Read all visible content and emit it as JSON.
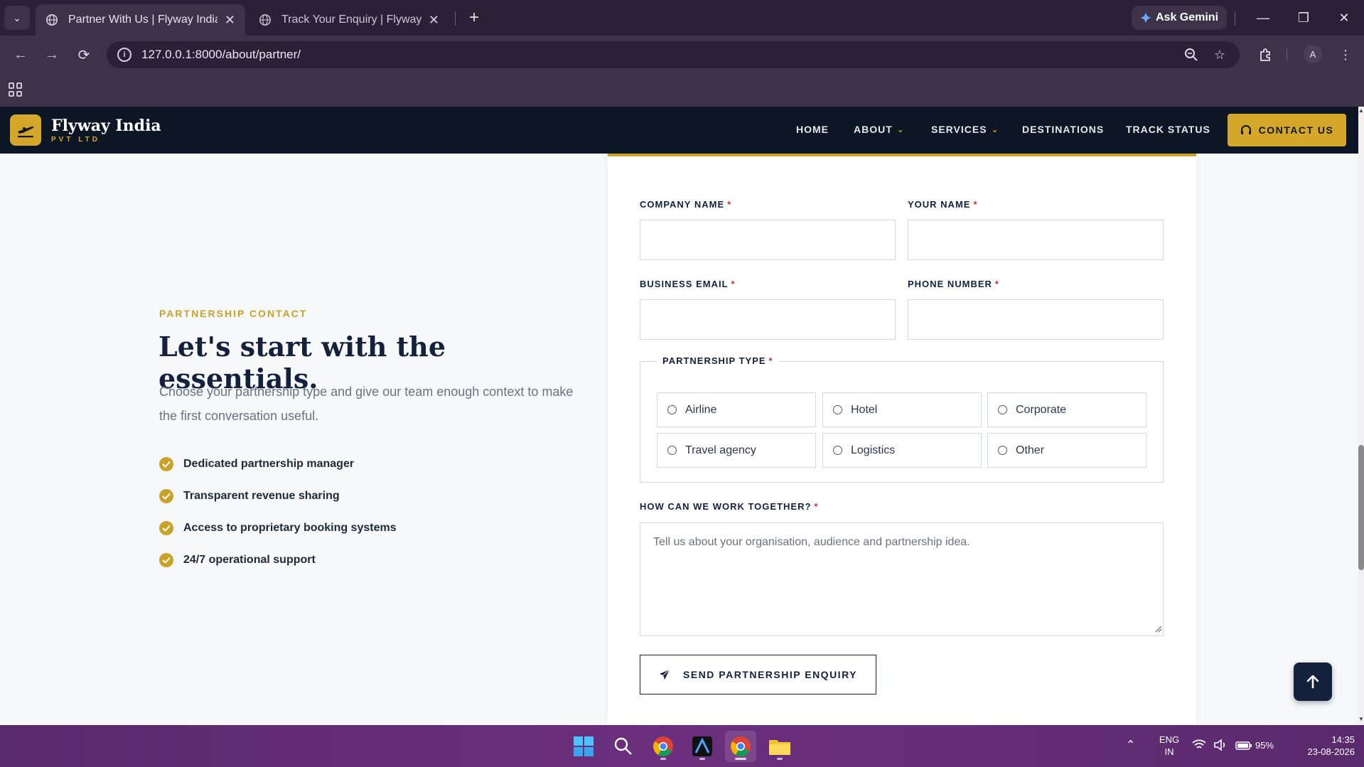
{
  "browser": {
    "tabs": [
      {
        "title": "Partner With Us | Flyway India",
        "active": true
      },
      {
        "title": "Track Your Enquiry | Flyway India",
        "active": false
      }
    ],
    "gemini_label": "Ask Gemini",
    "url": "127.0.0.1:8000/about/partner/",
    "profile_initial": "A"
  },
  "site": {
    "brand": "Flyway India",
    "brand_sub": "PVT LTD",
    "nav": {
      "home": "HOME",
      "about": "ABOUT",
      "services": "SERVICES",
      "destinations": "DESTINATIONS",
      "track": "TRACK STATUS",
      "contact": "CONTACT US"
    },
    "accent": "#c9a227",
    "navy": "#0d1624"
  },
  "intro": {
    "eyebrow": "PARTNERSHIP CONTACT",
    "headline": "Let's start with the essentials.",
    "lead": "Choose your partnership type and give our team enough context to make the first conversation useful.",
    "features": [
      "Dedicated partnership manager",
      "Transparent revenue sharing",
      "Access to proprietary booking systems",
      "24/7 operational support"
    ]
  },
  "form": {
    "company_label": "COMPANY NAME",
    "name_label": "YOUR NAME",
    "email_label": "BUSINESS EMAIL",
    "phone_label": "PHONE NUMBER",
    "required_mark": "*",
    "type_legend": "PARTNERSHIP TYPE",
    "types": [
      "Airline",
      "Hotel",
      "Corporate",
      "Travel agency",
      "Logistics",
      "Other"
    ],
    "message_label": "HOW CAN WE WORK TOGETHER?",
    "message_placeholder": "Tell us about your organisation, audience and partnership idea.",
    "submit": "SEND PARTNERSHIP ENQUIRY"
  },
  "taskbar": {
    "lang": "ENG",
    "region": "IN",
    "battery": "95%",
    "time": "14:35",
    "date": "23-08-2026"
  }
}
